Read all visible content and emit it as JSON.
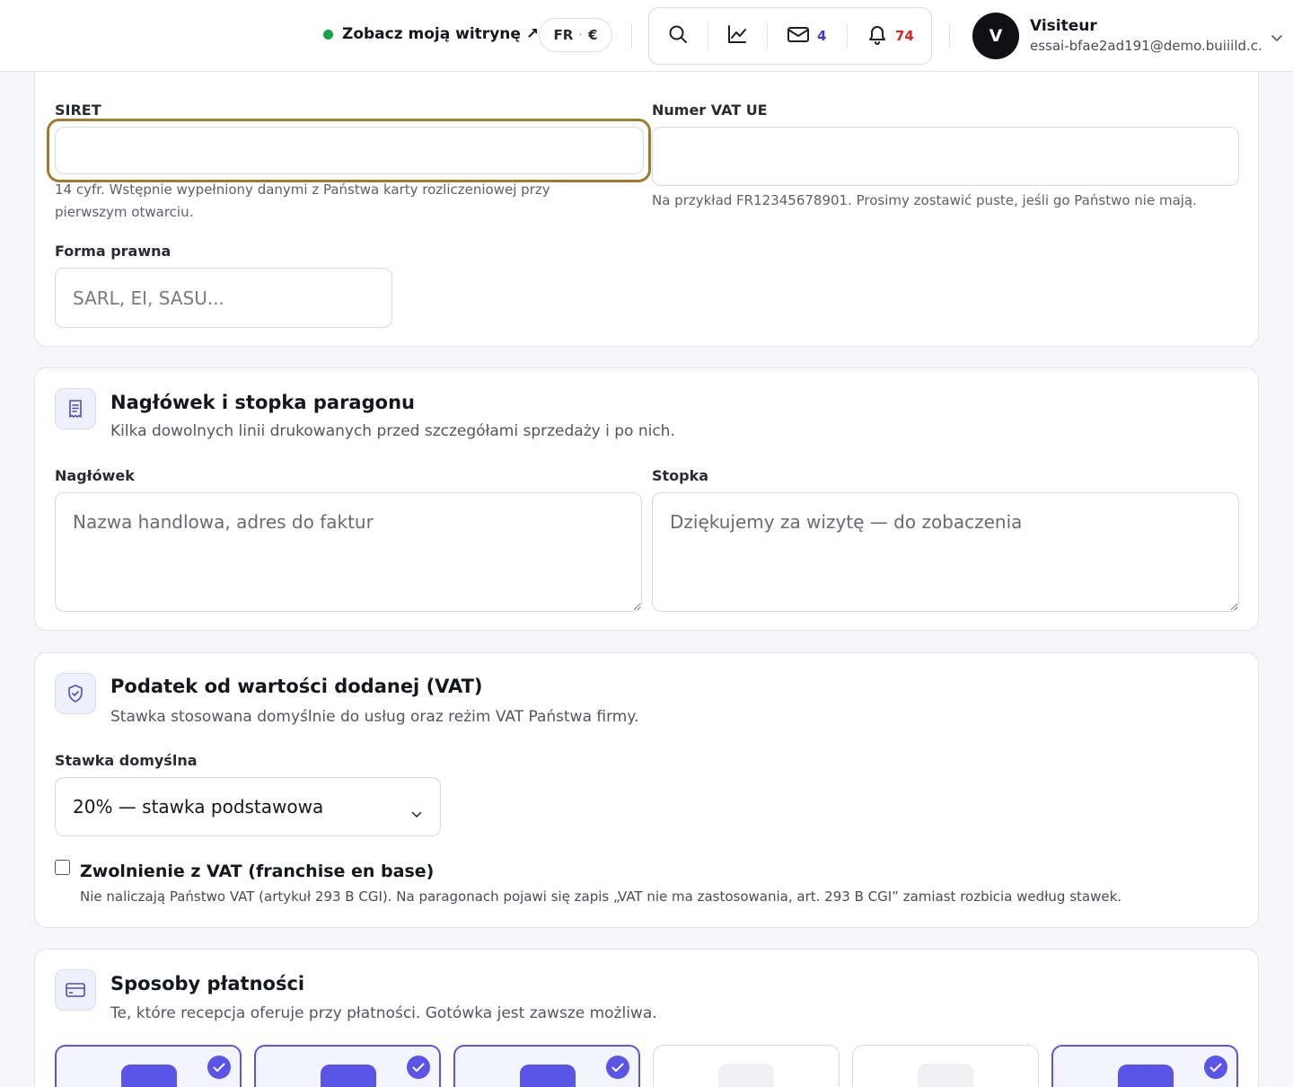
{
  "header": {
    "view_site_label": "Zobacz moją witrynę ↗",
    "language": "FR",
    "separator": "·",
    "currency": "€",
    "messages_count": "4",
    "notifications_count": "74",
    "user_initial": "V",
    "user_name": "Visiteur",
    "user_email": "essai-bfae2ad191@demo.buiiild.c..."
  },
  "company": {
    "siret_label": "SIRET",
    "siret_value": "",
    "siret_help": "14 cyfr. Wstępnie wypełniony danymi z Państwa karty rozliczeniowej przy pierwszym otwarciu.",
    "vat_label": "Numer VAT UE",
    "vat_value": "",
    "vat_help": "Na przykład FR12345678901. Prosimy zostawić puste, jeśli go Państwo nie mają.",
    "legal_form_label": "Forma prawna",
    "legal_form_placeholder": "SARL, EI, SASU..."
  },
  "receipt": {
    "title": "Nagłówek i stopka paragonu",
    "subtitle": "Kilka dowolnych linii drukowanych przed szczegółami sprzedaży i po nich.",
    "header_label": "Nagłówek",
    "header_placeholder": "Nazwa handlowa, adres do faktur",
    "footer_label": "Stopka",
    "footer_placeholder": "Dziękujemy za wizytę — do zobaczenia"
  },
  "vat": {
    "title": "Podatek od wartości dodanej (VAT)",
    "subtitle": "Stawka stosowana domyślnie do usług oraz reżim VAT Państwa firmy.",
    "rate_label": "Stawka domyślna",
    "rate_value": "20% — stawka podstawowa",
    "exempt_label": "Zwolnienie z VAT (franchise en base)",
    "exempt_checked": false,
    "exempt_help": "Nie naliczają Państwo VAT (artykuł 293 B CGI). Na paragonach pojawi się zapis „VAT nie ma zastosowania, art. 293 B CGI” zamiast rozbicia według stawek."
  },
  "payments": {
    "title": "Sposoby płatności",
    "subtitle": "Te, które recepcja oferuje przy płatności. Gotówka jest zawsze możliwa.",
    "methods_selected": [
      true,
      true,
      true,
      false,
      false,
      true
    ]
  },
  "colors": {
    "accent": "#5a55e6",
    "focus_ring": "#a07c2c",
    "online_dot": "#16a34a",
    "messages_count": "#4338ca",
    "notifications_count": "#dc2626"
  },
  "icons": [
    "arrow-up-right-icon",
    "search-icon",
    "chart-line-icon",
    "mail-icon",
    "bell-icon",
    "chevron-down-icon",
    "receipt-icon",
    "shield-check-icon",
    "credit-card-icon",
    "check-icon"
  ]
}
